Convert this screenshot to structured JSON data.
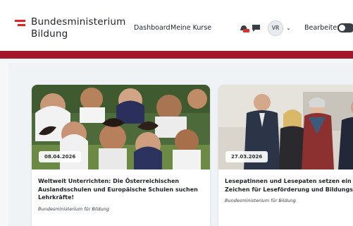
{
  "header": {
    "brand_line1": "Bundesministerium",
    "brand_line2": "Bildung",
    "nav": {
      "dashboard": "Dashboard",
      "courses": "Meine Kurse"
    },
    "user_initials": "VR",
    "edit_label": "Bearbeiten",
    "edit_mode_on": false
  },
  "colors": {
    "brand_red": "#a4172a",
    "logo_red": "#e3231f"
  },
  "icons": {
    "logo": "austria-flag-icon",
    "notifications": "bell-icon",
    "messages": "chat-icon",
    "caret": "chevron-down-icon"
  },
  "cards": [
    {
      "date": "08.04.2026",
      "title_lines": [
        "Weltweit Unterrichten: Die Österreichischen",
        "Auslandsschulen und Europäische Schulen suchen",
        "Lehrkräfte!"
      ],
      "author": "Bundesministerium für Bildung"
    },
    {
      "date": "27.03.2026",
      "title_lines": [
        "Lesepatinnen und Lesepaten setzen ein stark",
        "Zeichen für Leseförderung und Bildungsger"
      ],
      "author": "Bundesministerium für Bildung"
    }
  ]
}
